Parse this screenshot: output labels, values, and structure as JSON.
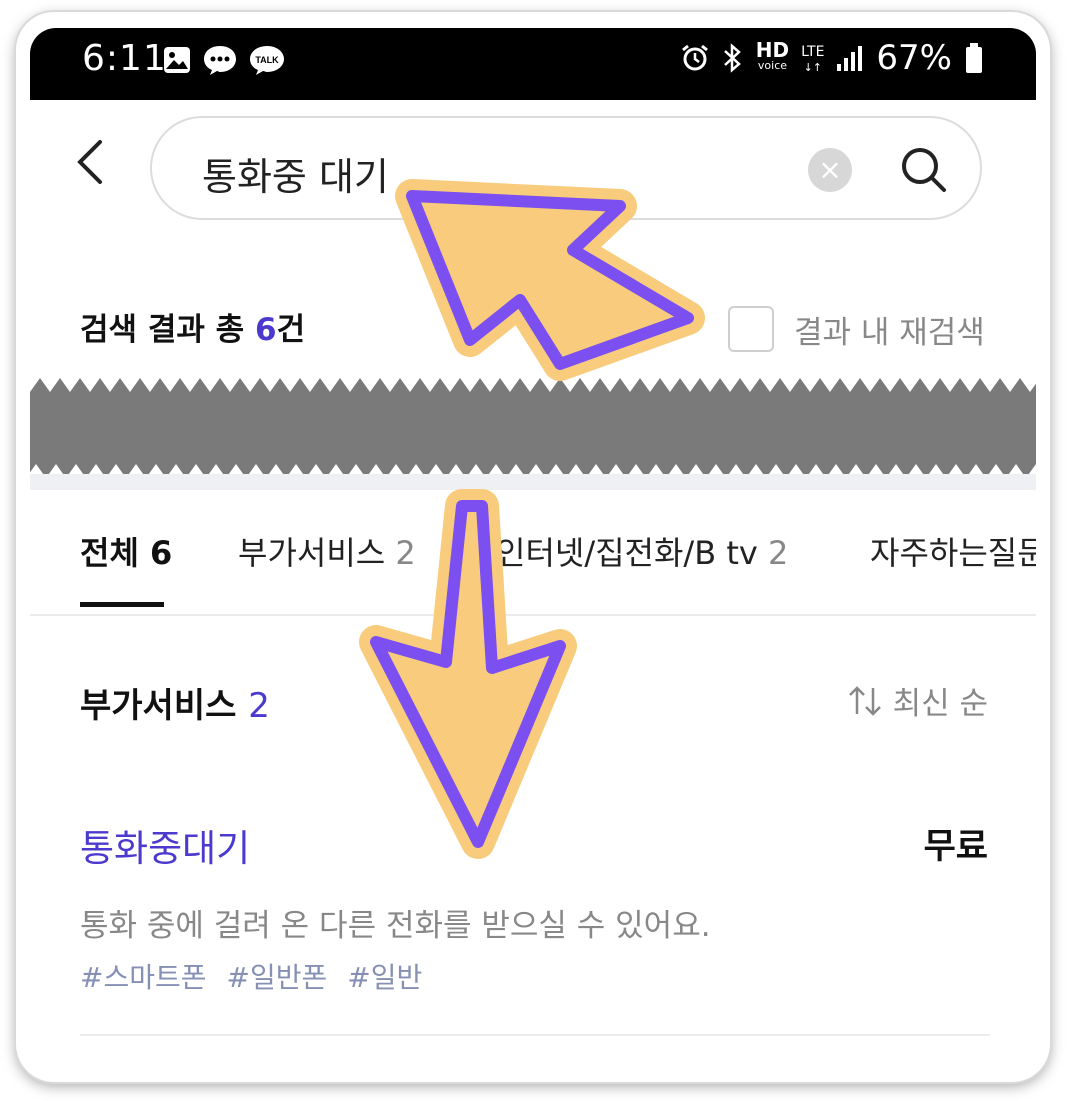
{
  "status_bar": {
    "time": "6:11",
    "left_icons": [
      "gallery-icon",
      "message-icon",
      "kakaotalk-icon"
    ],
    "kakaotalk_label": "TALK",
    "hd_label": "HD",
    "voice_label": "voice",
    "lte_label": "LTE",
    "battery": "67%"
  },
  "search": {
    "query": "통화중 대기"
  },
  "results": {
    "count_prefix": "검색 결과 총 ",
    "count": "6",
    "count_suffix": "건",
    "research_label": "결과 내 재검색"
  },
  "tabs": [
    {
      "label": "전체",
      "count": "6"
    },
    {
      "label": "부가서비스",
      "count": "2"
    },
    {
      "label": "인터넷/집전화/B tv",
      "count": "2"
    },
    {
      "label": "자주하는질문",
      "count": ""
    }
  ],
  "section": {
    "title": "부가서비스",
    "count": "2",
    "sort_label": "최신 순"
  },
  "item": {
    "title": "통화중대기",
    "price": "무료",
    "description": "통화 중에 걸려 온 다른 전화를 받으실 수 있어요.",
    "tags": [
      "#스마트폰",
      "#일반폰",
      "#일반"
    ]
  },
  "colors": {
    "accent": "#4b3acd",
    "arrow_fill": "#f8cc7c",
    "arrow_stroke": "#7b4ff0",
    "redaction": "#7a7a7a"
  }
}
